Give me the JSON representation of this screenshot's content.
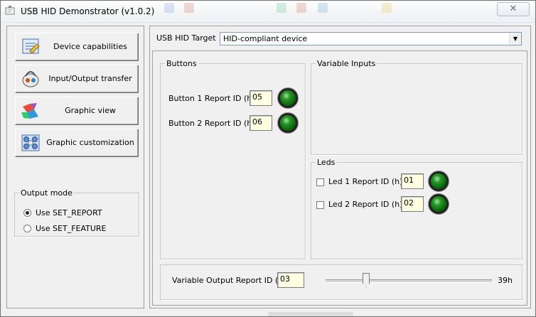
{
  "window": {
    "title": "USB HID Demonstrator (v1.0.2)",
    "close_symbol": "✕"
  },
  "nav": [
    {
      "label": "Device capabilities",
      "icon": "device-capabilities-icon"
    },
    {
      "label": "Input/Output transfer",
      "icon": "io-transfer-icon"
    },
    {
      "label": "Graphic view",
      "icon": "graphic-view-icon"
    },
    {
      "label": "Graphic customization",
      "icon": "graphic-customization-icon"
    }
  ],
  "output_mode": {
    "legend": "Output mode",
    "options": [
      {
        "label": "Use SET_REPORT",
        "selected": true
      },
      {
        "label": "Use SET_FEATURE",
        "selected": false
      }
    ]
  },
  "target": {
    "label": "USB HID Target",
    "value": "HID-compliant device"
  },
  "buttons_group": {
    "legend": "Buttons",
    "rows": [
      {
        "label": "Button 1 Report ID (h)",
        "value": "05"
      },
      {
        "label": "Button 2 Report ID (h)",
        "value": "06"
      }
    ]
  },
  "variable_inputs": {
    "legend": "Variable Inputs"
  },
  "leds_group": {
    "legend": "Leds",
    "rows": [
      {
        "label": "Led 1 Report ID (h)",
        "value": "01",
        "checked": false
      },
      {
        "label": "Led 2 Report ID (h)",
        "value": "02",
        "checked": false
      }
    ]
  },
  "variable_output": {
    "label": "Variable Output Report ID (h)",
    "value": "03",
    "slider_display": "39h"
  },
  "colors": {
    "led_on": "#0d6d0d",
    "field_bg": "#ffffe1",
    "window_bg": "#f0f0f0"
  }
}
